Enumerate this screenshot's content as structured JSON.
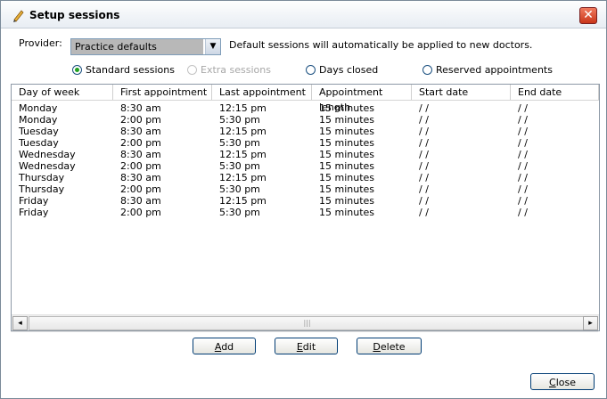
{
  "window": {
    "title": "Setup sessions",
    "close_glyph": "✕"
  },
  "provider": {
    "label": "Provider:",
    "selected": "Practice defaults",
    "note": "Default sessions will automatically be applied to new doctors."
  },
  "radios": [
    {
      "label": "Standard sessions",
      "checked": true,
      "disabled": false
    },
    {
      "label": "Extra sessions",
      "checked": false,
      "disabled": true
    },
    {
      "label": "Days closed",
      "checked": false,
      "disabled": false
    },
    {
      "label": "Reserved appointments",
      "checked": false,
      "disabled": false
    }
  ],
  "table": {
    "columns": [
      "Day of week",
      "First appointment",
      "Last appointment",
      "Appointment length",
      "Start date",
      "End date"
    ],
    "rows": [
      [
        "Monday",
        "8:30 am",
        "12:15 pm",
        "15 minutes",
        "/ /",
        "/ /"
      ],
      [
        "Monday",
        "2:00 pm",
        "5:30 pm",
        "15 minutes",
        "/ /",
        "/ /"
      ],
      [
        "Tuesday",
        "8:30 am",
        "12:15 pm",
        "15 minutes",
        "/ /",
        "/ /"
      ],
      [
        "Tuesday",
        "2:00 pm",
        "5:30 pm",
        "15 minutes",
        "/ /",
        "/ /"
      ],
      [
        "Wednesday",
        "8:30 am",
        "12:15 pm",
        "15 minutes",
        "/ /",
        "/ /"
      ],
      [
        "Wednesday",
        "2:00 pm",
        "5:30 pm",
        "15 minutes",
        "/ /",
        "/ /"
      ],
      [
        "Thursday",
        "8:30 am",
        "12:15 pm",
        "15 minutes",
        "/ /",
        "/ /"
      ],
      [
        "Thursday",
        "2:00 pm",
        "5:30 pm",
        "15 minutes",
        "/ /",
        "/ /"
      ],
      [
        "Friday",
        "8:30 am",
        "12:15 pm",
        "15 minutes",
        "/ /",
        "/ /"
      ],
      [
        "Friday",
        "2:00 pm",
        "5:30 pm",
        "15 minutes",
        "/ /",
        "/ /"
      ]
    ]
  },
  "scrollbar": {
    "left_glyph": "◂",
    "right_glyph": "▸",
    "grip_glyph": "|||"
  },
  "buttons": {
    "add": {
      "mnemonic": "A",
      "rest": "dd"
    },
    "edit": {
      "mnemonic": "E",
      "rest": "dit"
    },
    "delete": {
      "mnemonic": "D",
      "rest": "elete"
    },
    "close": {
      "mnemonic": "C",
      "rest": "lose"
    }
  },
  "dropdown_glyph": "▼"
}
